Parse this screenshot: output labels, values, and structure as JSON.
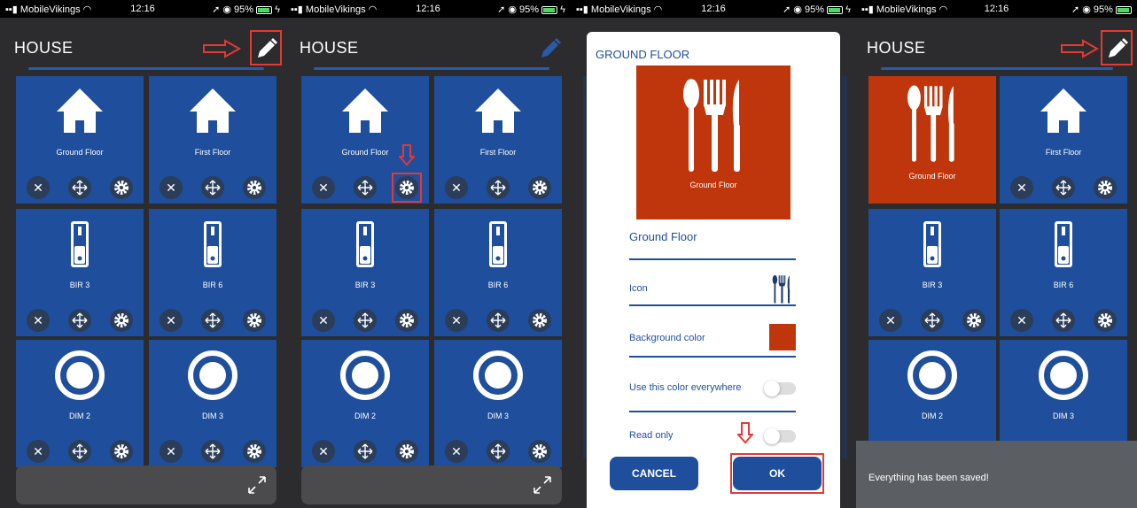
{
  "status_bar": {
    "carrier": "MobileVikings",
    "time": "12:16",
    "battery": "95%"
  },
  "screens": [
    {
      "title": "HOUSE",
      "tiles": [
        {
          "label": "Ground Floor",
          "icon": "house-icon"
        },
        {
          "label": "First Floor",
          "icon": "house-icon"
        },
        {
          "label": "BIR 3",
          "icon": "switch-icon"
        },
        {
          "label": "BIR 6",
          "icon": "switch-icon"
        },
        {
          "label": "DIM 2",
          "icon": "dimmer-icon"
        },
        {
          "label": "DIM 3",
          "icon": "dimmer-icon"
        }
      ]
    },
    {
      "title": "HOUSE",
      "tiles": [
        {
          "label": "Ground Floor",
          "icon": "house-icon"
        },
        {
          "label": "First Floor",
          "icon": "house-icon"
        },
        {
          "label": "BIR 3",
          "icon": "switch-icon"
        },
        {
          "label": "BIR 6",
          "icon": "switch-icon"
        },
        {
          "label": "DIM 2",
          "icon": "dimmer-icon"
        },
        {
          "label": "DIM 3",
          "icon": "dimmer-icon"
        }
      ]
    },
    {
      "title": "HOUSE",
      "tiles": [
        {
          "label": "Ground Floor",
          "icon": "cutlery-icon"
        },
        {
          "label": "First Floor",
          "icon": "house-icon"
        },
        {
          "label": "BIR 3",
          "icon": "switch-icon"
        },
        {
          "label": "BIR 6",
          "icon": "switch-icon"
        },
        {
          "label": "DIM 2",
          "icon": "dimmer-icon"
        },
        {
          "label": "DIM 3",
          "icon": "dimmer-icon"
        }
      ]
    }
  ],
  "dialog": {
    "title": "GROUND FLOOR",
    "preview_label": "Ground Floor",
    "name_value": "Ground Floor",
    "icon_label": "Icon",
    "bg_color_label": "Background color",
    "use_everywhere_label": "Use this color everywhere",
    "read_only_label": "Read only",
    "cancel_label": "CANCEL",
    "ok_label": "OK",
    "use_everywhere_on": false,
    "read_only_on": false
  },
  "toast": "Everything has been saved!",
  "colors": {
    "tile_blue": "#1e4e9c",
    "tile_orange": "#c0360c",
    "annotation_red": "#e53935"
  }
}
